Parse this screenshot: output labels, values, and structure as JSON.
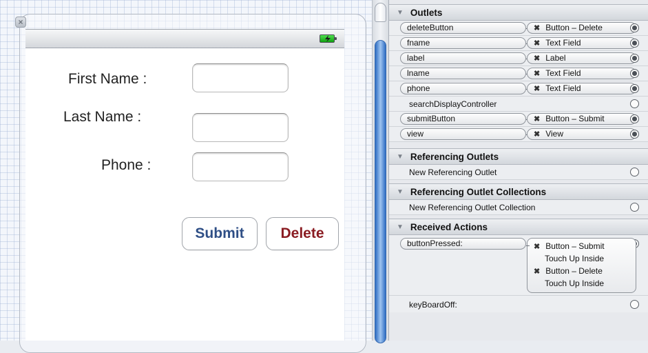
{
  "form": {
    "first_name_label": "First Name :",
    "last_name_label": "Last Name :",
    "phone_label": "Phone :",
    "first_name_value": "",
    "last_name_value": "",
    "phone_value": "",
    "submit_label": "Submit",
    "delete_label": "Delete",
    "submit_color": "#2f4f86",
    "delete_color": "#8a1c22"
  },
  "inspector": {
    "outlets_header": "Outlets",
    "outlets": [
      {
        "name": "deleteButton",
        "target": "Button – Delete",
        "connected": true
      },
      {
        "name": "fname",
        "target": "Text Field",
        "connected": true
      },
      {
        "name": "label",
        "target": "Label",
        "connected": true
      },
      {
        "name": "lname",
        "target": "Text Field",
        "connected": true
      },
      {
        "name": "phone",
        "target": "Text Field",
        "connected": true
      },
      {
        "name": "searchDisplayController",
        "target": "",
        "connected": false
      },
      {
        "name": "submitButton",
        "target": "Button – Submit",
        "connected": true
      },
      {
        "name": "view",
        "target": "View",
        "connected": true
      }
    ],
    "referencing_outlets_header": "Referencing Outlets",
    "new_referencing_outlet": "New Referencing Outlet",
    "referencing_collections_header": "Referencing Outlet Collections",
    "new_referencing_collection": "New Referencing Outlet Collection",
    "received_actions_header": "Received Actions",
    "actions": [
      {
        "name": "buttonPressed:",
        "connections": [
          {
            "target": "Button – Submit",
            "event": "Touch Up Inside"
          },
          {
            "target": "Button – Delete",
            "event": "Touch Up Inside"
          }
        ]
      },
      {
        "name": "keyBoardOff:"
      }
    ],
    "x_glyph": "✖"
  },
  "icons": {
    "close": "close-icon",
    "battery": "battery-charging-icon",
    "disclosure": "disclosure-triangle-icon"
  }
}
